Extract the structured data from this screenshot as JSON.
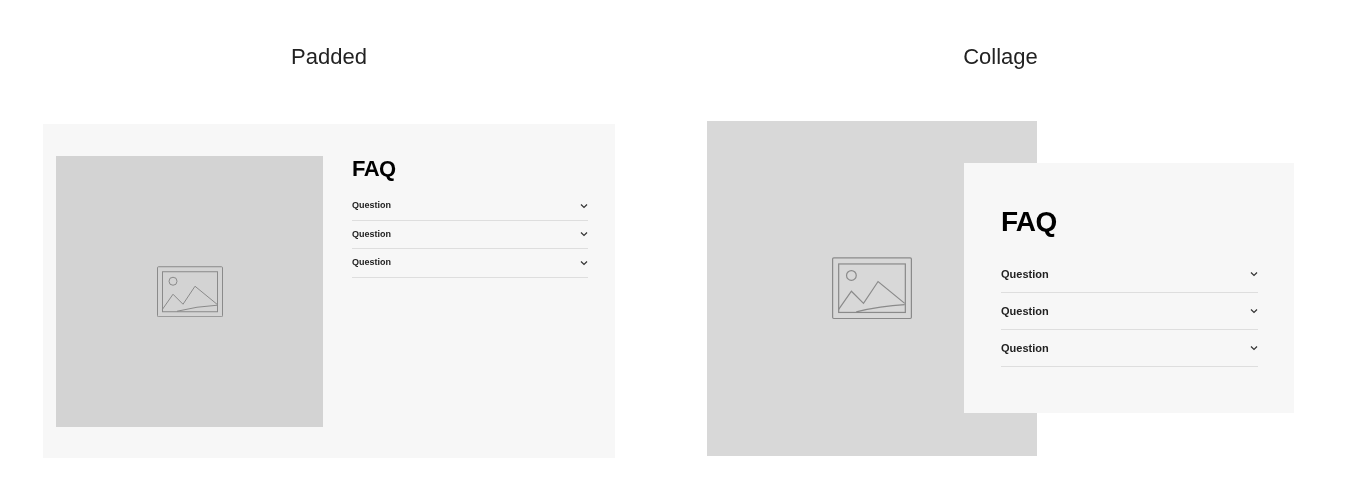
{
  "variants": [
    {
      "kind": "padded",
      "label": "Padded",
      "faq": {
        "title": "FAQ",
        "items": [
          {
            "question": "Question",
            "expanded": false
          },
          {
            "question": "Question",
            "expanded": false
          },
          {
            "question": "Question",
            "expanded": false
          }
        ]
      }
    },
    {
      "kind": "collage",
      "label": "Collage",
      "faq": {
        "title": "FAQ",
        "items": [
          {
            "question": "Question",
            "expanded": false
          },
          {
            "question": "Question",
            "expanded": false
          },
          {
            "question": "Question",
            "expanded": false
          }
        ]
      }
    }
  ]
}
